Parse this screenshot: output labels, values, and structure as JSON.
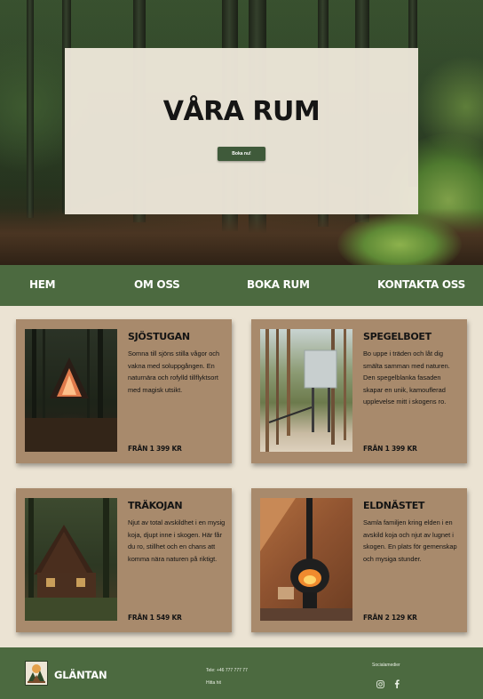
{
  "hero": {
    "title": "VÅRA RUM",
    "button_label": "Boka nu!"
  },
  "nav": {
    "items": [
      {
        "label": "HEM"
      },
      {
        "label": "OM OSS"
      },
      {
        "label": "BOKA RUM"
      },
      {
        "label": "KONTAKTA OSS"
      }
    ]
  },
  "rooms": [
    {
      "title": "SJÖSTUGAN",
      "description": "Somna till sjöns stilla vågor och vakna med soluppgången. En naturnära och rofylld tillflyktsort med magisk utsikt.",
      "price": "FRÅN 1 399 KR",
      "image": "a-frame-cabin-in-forest-photo"
    },
    {
      "title": "SPEGELBOET",
      "description": "Bo uppe i träden och låt dig smälta samman med naturen. Den spegelblanka fasaden skapar en unik, kamouflerad upplevelse mitt i skogens ro.",
      "price": "FRÅN 1 399 KR",
      "image": "mirror-treehouse-photo"
    },
    {
      "title": "TRÄKOJAN",
      "description": "Njut av total avskildhet i en mysig koja, djupt inne i skogen. Här får du ro, stillhet och en chans att komma nära naturen på riktigt.",
      "price": "FRÅN 1 549 KR",
      "image": "wooden-cabin-photo"
    },
    {
      "title": "ELDNÄSTET",
      "description": "Samla familjen kring elden i en avskild koja och njut av lugnet i skogen. En plats för gemenskap och mysiga stunder.",
      "price": "FRÅN 2 129 KR",
      "image": "fireplace-interior-photo"
    }
  ],
  "footer": {
    "brand": "GLÄNTAN",
    "phone": "Tele: +46 777 777 77",
    "find_us": "Hitta hit",
    "social_heading": "Socialamedier",
    "social_icons": [
      "instagram-icon",
      "facebook-icon"
    ]
  },
  "colors": {
    "green": "#4c6a40",
    "card_brown": "#a88a6c",
    "background": "#ebe3d3",
    "button_green": "#3f5a3a"
  }
}
